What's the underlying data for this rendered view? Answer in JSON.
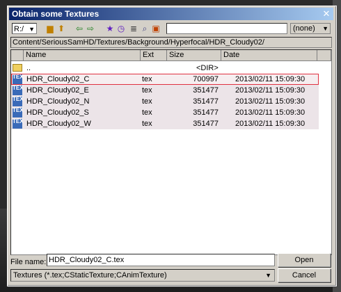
{
  "window": {
    "title": "Obtain some Textures",
    "close_glyph": "✕"
  },
  "toolbar": {
    "drive": "R:/",
    "search_value": "",
    "filter": "(none)",
    "icons": [
      "folder-icon",
      "folder-up-icon",
      "back-icon",
      "forward-icon",
      "favorite-star-icon",
      "history-icon",
      "list-view-icon",
      "find-icon",
      "bookmark-icon"
    ]
  },
  "path": "Content/SeriousSamHD/Textures/Background/Hyperfocal/HDR_Cloudy02/",
  "columns": {
    "name": "Name",
    "ext": "Ext",
    "size": "Size",
    "date": "Date"
  },
  "parent_row": {
    "name": "..",
    "size": "<DIR>"
  },
  "files": [
    {
      "name": "HDR_Cloudy02_C",
      "ext": "tex",
      "size": "700997",
      "date": "2013/02/11  15:09:30"
    },
    {
      "name": "HDR_Cloudy02_E",
      "ext": "tex",
      "size": "351477",
      "date": "2013/02/11  15:09:30"
    },
    {
      "name": "HDR_Cloudy02_N",
      "ext": "tex",
      "size": "351477",
      "date": "2013/02/11  15:09:30"
    },
    {
      "name": "HDR_Cloudy02_S",
      "ext": "tex",
      "size": "351477",
      "date": "2013/02/11  15:09:30"
    },
    {
      "name": "HDR_Cloudy02_W",
      "ext": "tex",
      "size": "351477",
      "date": "2013/02/11  15:09:30"
    }
  ],
  "footer": {
    "file_name_label": "File name:",
    "file_name_value": "HDR_Cloudy02_C.tex",
    "type_value": "Textures (*.tex;CStaticTexture;CAnimTexture)",
    "open_label": "Open",
    "cancel_label": "Cancel"
  }
}
